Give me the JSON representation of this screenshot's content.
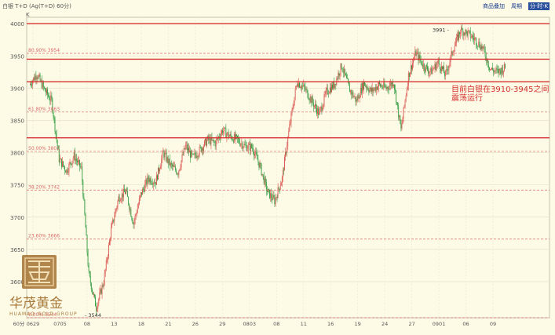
{
  "header": {
    "title": "白银 T+D (Ag(T+D) 60分)",
    "unit_label": "K",
    "buttons": [
      "商品叠加",
      "周期",
      "分·时·K"
    ]
  },
  "watermark": {
    "brand_cn": "华茂黄金",
    "brand_en": "HUAMAO GOLD GROUP"
  },
  "chart_data": {
    "type": "candlestick",
    "ylim": [
      3544,
      4010
    ],
    "y_ticks": [
      4000,
      3950,
      3900,
      3850,
      3800,
      3750,
      3700,
      3650,
      3600
    ],
    "y_tick_labels": [
      "4000",
      "3950",
      "3900",
      "3850",
      "3800",
      "3750",
      "3700",
      "3650",
      "3600"
    ],
    "x_tick_labels": [
      "60分",
      "0629",
      "0705",
      "08",
      "13",
      "18",
      "21",
      "26",
      "29",
      "0803",
      "08",
      "11",
      "16",
      "19",
      "24",
      "27",
      "0901",
      "06",
      "09"
    ],
    "fib_levels": [
      {
        "label": "80.90% 3954",
        "value": 3954
      },
      {
        "label": "61.80% 3863",
        "value": 3863
      },
      {
        "label": "50.00% 3802",
        "value": 3802
      },
      {
        "label": "38.20% 3742",
        "value": 3742
      },
      {
        "label": "23.60% 3666",
        "value": 3666
      },
      {
        "label": "0.00% 3544",
        "value": 3544
      }
    ],
    "support_lines": [
      4000,
      3945,
      3910,
      3823
    ],
    "annotations": [
      {
        "text": "3991",
        "value": 3991
      },
      {
        "text": "3544",
        "value": 3544
      }
    ],
    "note": "目前白银在3910-3945之间震荡运行",
    "colors": {
      "up": "#d9534f",
      "down": "#2e9a3e",
      "support": "#d63030",
      "fib": "#d96a6a",
      "note": "#d63030",
      "axis": "#555555"
    },
    "price_path": [
      3905,
      3922,
      3898,
      3880,
      3790,
      3772,
      3795,
      3775,
      3610,
      3560,
      3600,
      3680,
      3730,
      3740,
      3690,
      3735,
      3760,
      3755,
      3800,
      3780,
      3770,
      3810,
      3792,
      3805,
      3820,
      3815,
      3835,
      3825,
      3820,
      3810,
      3808,
      3780,
      3740,
      3725,
      3760,
      3840,
      3910,
      3900,
      3880,
      3860,
      3895,
      3905,
      3935,
      3900,
      3880,
      3908,
      3895,
      3905,
      3900,
      3910,
      3835,
      3920,
      3955,
      3935,
      3925,
      3940,
      3920,
      3960,
      3990,
      3985,
      3975,
      3962,
      3930,
      3925,
      3932
    ]
  }
}
